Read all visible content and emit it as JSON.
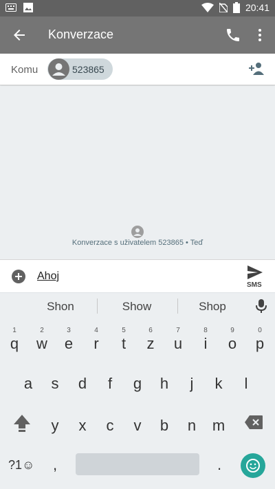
{
  "status_bar": {
    "time": "20:41"
  },
  "app_bar": {
    "title": "Konverzace"
  },
  "recipient": {
    "label": "Komu",
    "chip_text": "523865"
  },
  "conversation": {
    "info": "Konverzace s uživatelem 523865 • Teď"
  },
  "compose": {
    "value": "Ahoj",
    "send_type": "SMS"
  },
  "suggestions": [
    "Shon",
    "Show",
    "Shop"
  ],
  "keyboard": {
    "row1": [
      {
        "hint": "1",
        "char": "q"
      },
      {
        "hint": "2",
        "char": "w"
      },
      {
        "hint": "3",
        "char": "e"
      },
      {
        "hint": "4",
        "char": "r"
      },
      {
        "hint": "5",
        "char": "t"
      },
      {
        "hint": "6",
        "char": "z"
      },
      {
        "hint": "7",
        "char": "u"
      },
      {
        "hint": "8",
        "char": "i"
      },
      {
        "hint": "9",
        "char": "o"
      },
      {
        "hint": "0",
        "char": "p"
      }
    ],
    "row2": [
      "a",
      "s",
      "d",
      "f",
      "g",
      "h",
      "j",
      "k",
      "l"
    ],
    "row3": [
      "y",
      "x",
      "c",
      "v",
      "b",
      "n",
      "m"
    ],
    "symbols_label": "?1☺",
    "comma": ",",
    "period": "."
  },
  "icons": {
    "back": "arrow-back-icon",
    "call": "phone-icon",
    "more": "more-vert-icon",
    "add_person": "person-add-icon",
    "attach": "add-circle-icon",
    "send": "send-icon",
    "mic": "mic-icon",
    "shift": "shift-icon",
    "backspace": "backspace-icon",
    "emoji": "emoji-icon"
  },
  "colors": {
    "app_bar": "#757575",
    "status_bar": "#616161",
    "emoji_button": "#26a69a"
  }
}
